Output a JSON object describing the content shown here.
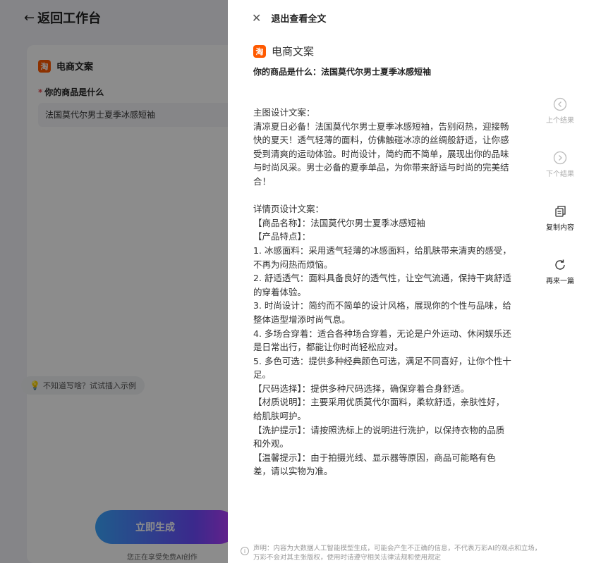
{
  "background": {
    "back_arrow": "←",
    "back_label": "返回工作台",
    "card_badge": "淘",
    "card_title": "电商文案",
    "field_required_mark": "*",
    "field_label": "你的商品是什么",
    "field_value": "法国莫代尔男士夏季冰感短袖",
    "hint_text": "不知道写啥？试试插入示例",
    "generate_label": "立即生成",
    "free_notice": "您正在享受免费AI创作"
  },
  "drawer": {
    "exit_label": "退出查看全文",
    "badge": "淘",
    "doc_title": "电商文案",
    "question": "你的商品是什么：法国莫代尔男士夏季冰感短袖",
    "content": "主图设计文案：\n清凉夏日必备！法国莫代尔男士夏季冰感短袖，告别闷热，迎接畅快的夏天！透气轻薄的面料，仿佛触碰冰凉的丝绸般舒适，让你感受到清爽的运动体验。时尚设计，简约而不简单，展现出你的品味与时尚风采。男士必备的夏季单品，为你带来舒适与时尚的完美结合！\n\n详情页设计文案：\n【商品名称】：法国莫代尔男士夏季冰感短袖\n【产品特点】：\n1. 冰感面料：采用透气轻薄的冰感面料，给肌肤带来清爽的感受，不再为闷热而烦恼。\n2. 舒适透气：面料具备良好的透气性，让空气流通，保持干爽舒适的穿着体验。\n3. 时尚设计：简约而不简单的设计风格，展现你的个性与品味，给整体造型增添时尚气息。\n4. 多场合穿着：适合各种场合穿着，无论是户外运动、休闲娱乐还是日常出行，都能让你时尚轻松应对。\n5. 多色可选：提供多种经典颜色可选，满足不同喜好，让你个性十足。\n【尺码选择】：提供多种尺码选择，确保穿着合身舒适。\n【材质说明】：主要采用优质莫代尔面料，柔软舒适，亲肤性好，给肌肤呵护。\n【洗护提示】：请按照洗标上的说明进行洗护，以保持衣物的品质和外观。\n【温馨提示】：由于拍摄光线、显示器等原因，商品可能略有色差，请以实物为准。",
    "actions": {
      "prev": "上个结果",
      "next": "下个结果",
      "copy": "复制内容",
      "redo": "再来一篇"
    },
    "disclaimer": "声明：内容为大数据人工智能模型生成，可能会产生不正确的信息，不代表万彩AI的观点和立场，万彩不会对其主张版权，使用时请遵守相关法律法规和使用规定"
  },
  "colors": {
    "brand_badge": "#ff5a00",
    "overlay": "rgba(0,0,0,0.45)",
    "generate_gradient_start": "#3aa6ff",
    "generate_gradient_end": "#c13cff"
  },
  "icons": {
    "close": "close-icon",
    "prev": "chevron-up-circle-icon",
    "next": "chevron-down-circle-icon",
    "copy": "copy-icon",
    "redo": "refresh-icon",
    "info": "info-icon",
    "hint": "lightbulb-icon"
  }
}
